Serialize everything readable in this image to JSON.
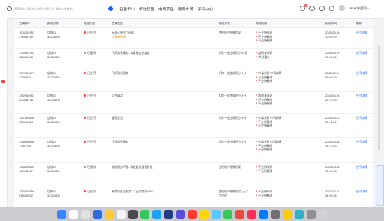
{
  "header": {
    "search_placeholder": "搜索服务 切换抖店账号 快速定位 请输入关键词",
    "nav": [
      "巨量千川",
      "精选联盟",
      "电商罗盘",
      "服务市场",
      "学习中心"
    ],
    "badge_count": "2",
    "username": "SENZ神秘贸易..."
  },
  "table": {
    "columns": [
      "工单编号",
      "处理对象",
      "处理状态",
      "工单类型",
      "处理方式",
      "处理结果",
      "处理时间",
      "操作"
    ],
    "rows": [
      {
        "id": "7605262957\n274682180",
        "obj": "店铺ID\n32326806",
        "status": "已处罚",
        "type": "无效订单支付退款",
        "sub": "优惠券违规",
        "way": "违规账户限制提现",
        "results": [
          "不支持申诉",
          "不支持整改",
          "不支持复核"
        ],
        "time": "2025-05-26\n10:33:49",
        "op": "处罚详情"
      },
      {
        "id": "7309051953\n626810066",
        "obj": "店铺ID\n32326806",
        "status": "已撤销",
        "type": "飞鸽消息服务--商家服务态度差",
        "sub": "",
        "way": "扣除一般违规积分:12分",
        "results": [
          "超时未申诉",
          "考试通过"
        ],
        "time": "2025-05-09\n10:50:26",
        "op": "处罚详情"
      },
      {
        "id": "7372303376\n21705531",
        "obj": "店铺ID\n32326806",
        "status": "已处罚",
        "type": "飞鸽消息服务",
        "sub": "",
        "way": "扣除一般违规积分:4分",
        "results": [
          "申诉失败 申诉详情",
          "不支持整改",
          "不支持复核"
        ],
        "time": "2025-05-24\n05:01:53",
        "op": "处罚详情"
      },
      {
        "id": "7362919957\n202838776",
        "obj": "店铺ID\n32326806",
        "status": "已处罚",
        "type": "少件漏发",
        "sub": "",
        "way": "扣除一般违规积分:8分",
        "results": [
          "超时未申诉",
          "不支持整改",
          "不支持复核"
        ],
        "time": "2024-04-26\n22:10:35",
        "op": "处罚详情"
      },
      {
        "id": "7361049808\n785516314",
        "obj": "店铺ID\n32326806",
        "status": "已处罚",
        "type": "虚假发货",
        "sub": "",
        "way": "扣除一般违规积分:8分",
        "results": [
          "申诉失败 申诉详情",
          "不支持整改",
          "不支持复核"
        ],
        "time": "2024-04-23\n22:12:24",
        "op": "处罚详情"
      },
      {
        "id": "7358040856\n77557701",
        "obj": "店铺ID\n32326806",
        "status": "已处罚",
        "type": "飞鸽消息服务",
        "sub": "",
        "way": "扣除一般违规积分:2分",
        "results": [
          "申诉失败 申诉详情",
          "不支持整改",
          "不支持复核"
        ],
        "time": "2024-04-16\n17:17:45",
        "op": "处罚详情"
      },
      {
        "id": "7344259204\n169694457",
        "obj": "店铺ID\n32326806",
        "status": "已撤销",
        "type": "物流服务不足--揽收延迟虚假揽收",
        "sub": "",
        "way": "违规账户限制提现",
        "results": [
          "不支持申诉",
          "不支持整改"
        ],
        "time": "2024-03-08\n12:03:38",
        "op": "处罚详情"
      },
      {
        "id": "7338425556\n538942932",
        "obj": "店铺ID\n32326806",
        "status": "已处罚",
        "type": "新商家延迟发货（7日内商家1001）",
        "sub": "",
        "way": "违规账户限制提现7天,7\n个违规",
        "results": [
          "不支持申诉",
          "不支持整改"
        ],
        "time": "2024-02-22\n21:59:36",
        "op": "处罚详情"
      }
    ]
  },
  "dock_colors": [
    "#3a86ff",
    "#ffffff",
    "#e0e0e0",
    "#2d6cdf",
    "#ffcc33",
    "#f5f5f5",
    "#4a4a4a",
    "#35c759",
    "#1da1f2",
    "#223b86",
    "#5b4cdb",
    "#ff3b30",
    "#ffd60a",
    "#5ac8fa",
    "#34c759",
    "#e74c3c",
    "#ff2d55",
    "#007aff",
    "#6e6e73",
    "#ffcc00",
    "#30b0c7",
    "#8e8e93",
    "#d1d1d6"
  ]
}
